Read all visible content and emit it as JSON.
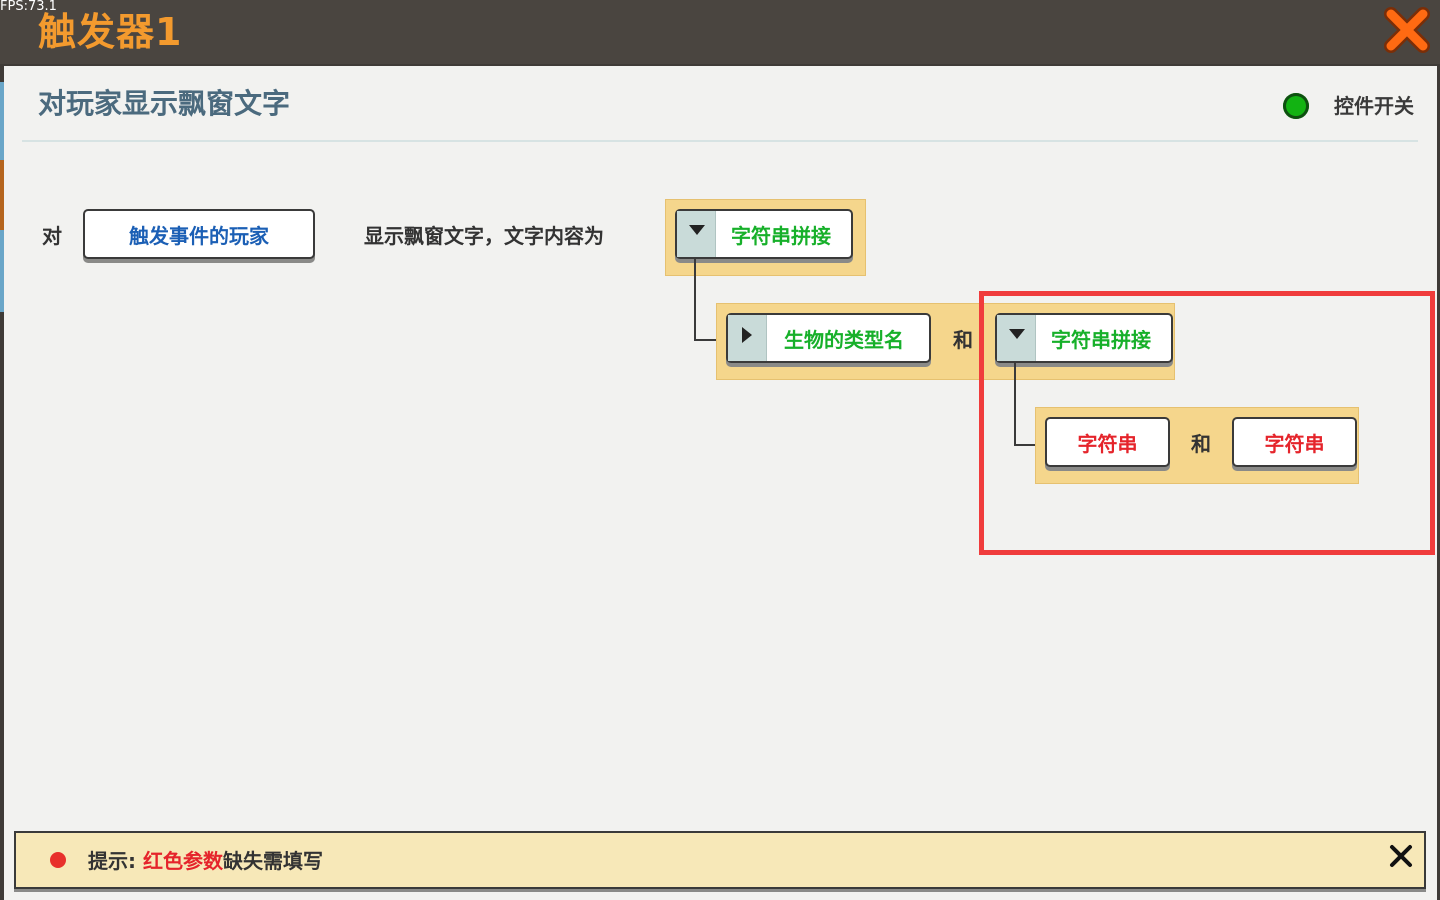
{
  "fps": "FPS:73.1",
  "window": {
    "title": "触发器1",
    "close_icon": "close-x-icon"
  },
  "header": {
    "title": "对玩家显示飘窗文字",
    "toggle_label": "控件开关",
    "toggle_color": "#12b312"
  },
  "statement": {
    "prefix": "对",
    "player_param": "触发事件的玩家",
    "middle": "显示飘窗文字，文字内容为",
    "concat1": "字符串拼接",
    "creature_param": "生物的类型名",
    "and1": "和",
    "concat2": "字符串拼接",
    "string1": "字符串",
    "and2": "和",
    "string2": "字符串"
  },
  "hint": {
    "label": "提示:",
    "red_text": "红色参数",
    "rest": "缺失需填写",
    "dot_color": "#e8302b"
  },
  "colors": {
    "accent_orange": "#f39a2e",
    "param_blue": "#1b5fb5",
    "param_green": "#17b02a",
    "param_red": "#e5242b",
    "highlight": "#f03c3c"
  }
}
